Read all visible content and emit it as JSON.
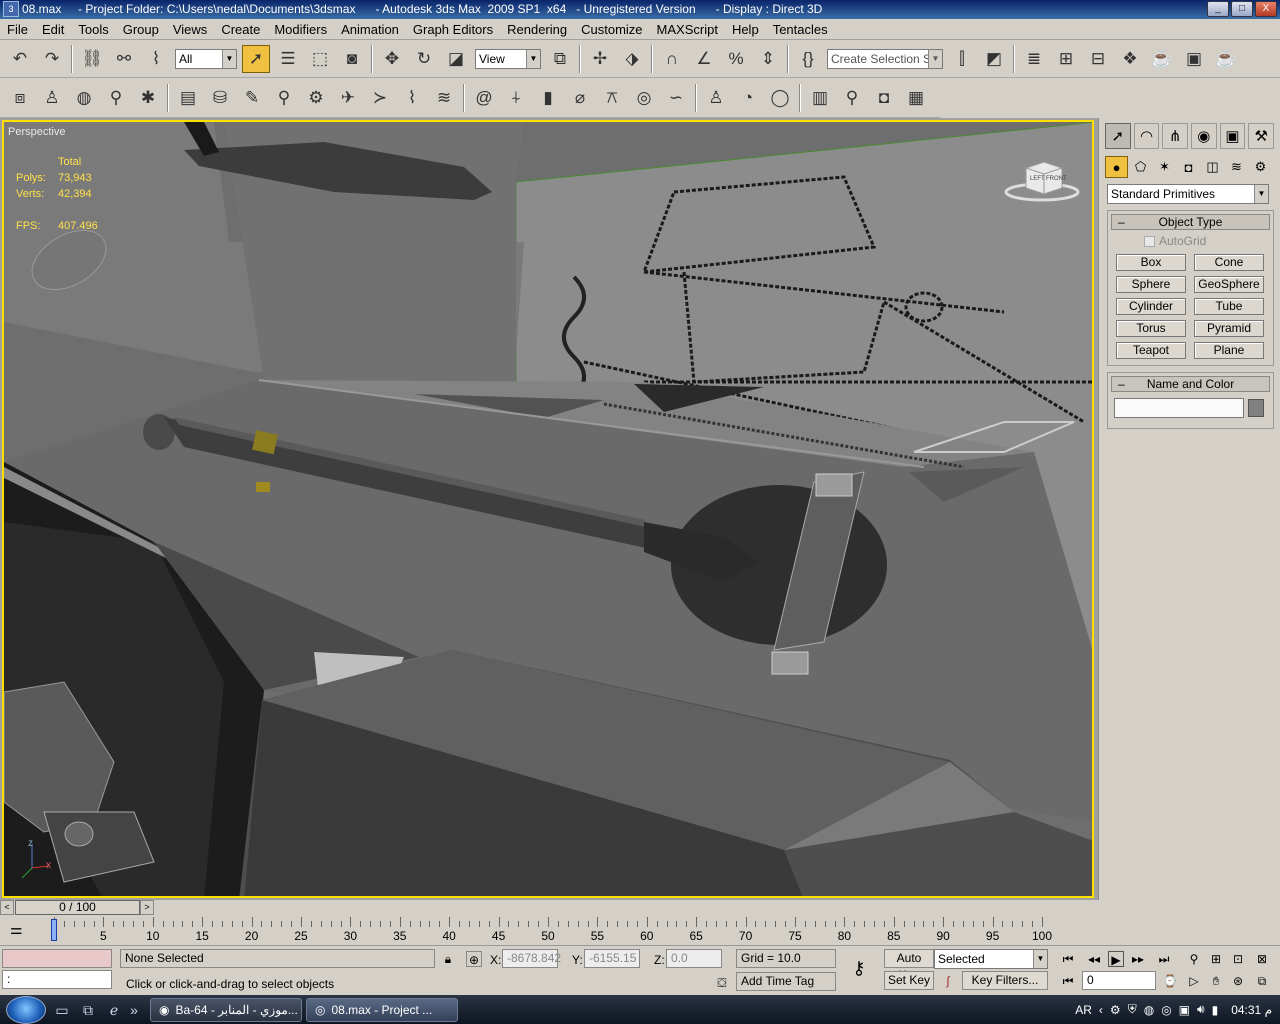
{
  "window": {
    "title": "08.max     - Project Folder: C:\\Users\\nedal\\Documents\\3dsmax      - Autodesk 3ds Max  2009 SP1  x64   - Unregistered Version      - Display : Direct 3D",
    "controls": [
      "_",
      "□",
      "X"
    ]
  },
  "menu": [
    "File",
    "Edit",
    "Tools",
    "Group",
    "Views",
    "Create",
    "Modifiers",
    "Animation",
    "Graph Editors",
    "Rendering",
    "Customize",
    "MAXScript",
    "Help",
    "Tentacles"
  ],
  "toolbar": {
    "selection_filter": "All",
    "ref_coord": "View",
    "named_selection_placeholder": "Create Selection Set"
  },
  "viewport": {
    "label": "Perspective",
    "stats": {
      "header": "Total",
      "polys_label": "Polys:",
      "polys": "73,943",
      "verts_label": "Verts:",
      "verts": "42,394",
      "fps_label": "FPS:",
      "fps": "407.496"
    },
    "cube_left": "LEFT",
    "cube_front": "FRONT",
    "axis": {
      "z": "z",
      "x": "x"
    }
  },
  "command_panel": {
    "category": "Standard Primitives",
    "object_type_title": "Object Type",
    "autogrid": "AutoGrid",
    "buttons": [
      "Box",
      "Cone",
      "Sphere",
      "GeoSphere",
      "Cylinder",
      "Tube",
      "Torus",
      "Pyramid",
      "Teapot",
      "Plane"
    ],
    "name_color_title": "Name and Color"
  },
  "timeline": {
    "frame": "0 / 100",
    "ticks": [
      "0",
      "5",
      "10",
      "15",
      "20",
      "25",
      "30",
      "35",
      "40",
      "45",
      "50",
      "55",
      "60",
      "65",
      "70",
      "75",
      "80",
      "85",
      "90",
      "95",
      "100"
    ]
  },
  "status": {
    "selection": "None Selected",
    "prompt": "Click or click-and-drag to select objects",
    "maxscript": ":",
    "x_label": "X:",
    "x": "-8678.842",
    "y_label": "Y:",
    "y": "-6155.15",
    "z_label": "Z:",
    "z": "0.0",
    "grid": "Grid = 10.0",
    "add_time_tag": "Add Time Tag",
    "auto_key": "Auto Key",
    "set_key": "Set Key",
    "key_mode": "Selected",
    "key_filters": "Key Filters...",
    "current_frame": "0"
  },
  "taskbar": {
    "tasks": [
      "Ba-64 - موزي - المنابر...",
      "08.max     - Project ..."
    ],
    "lang": "AR",
    "clock": "04:31 م"
  }
}
